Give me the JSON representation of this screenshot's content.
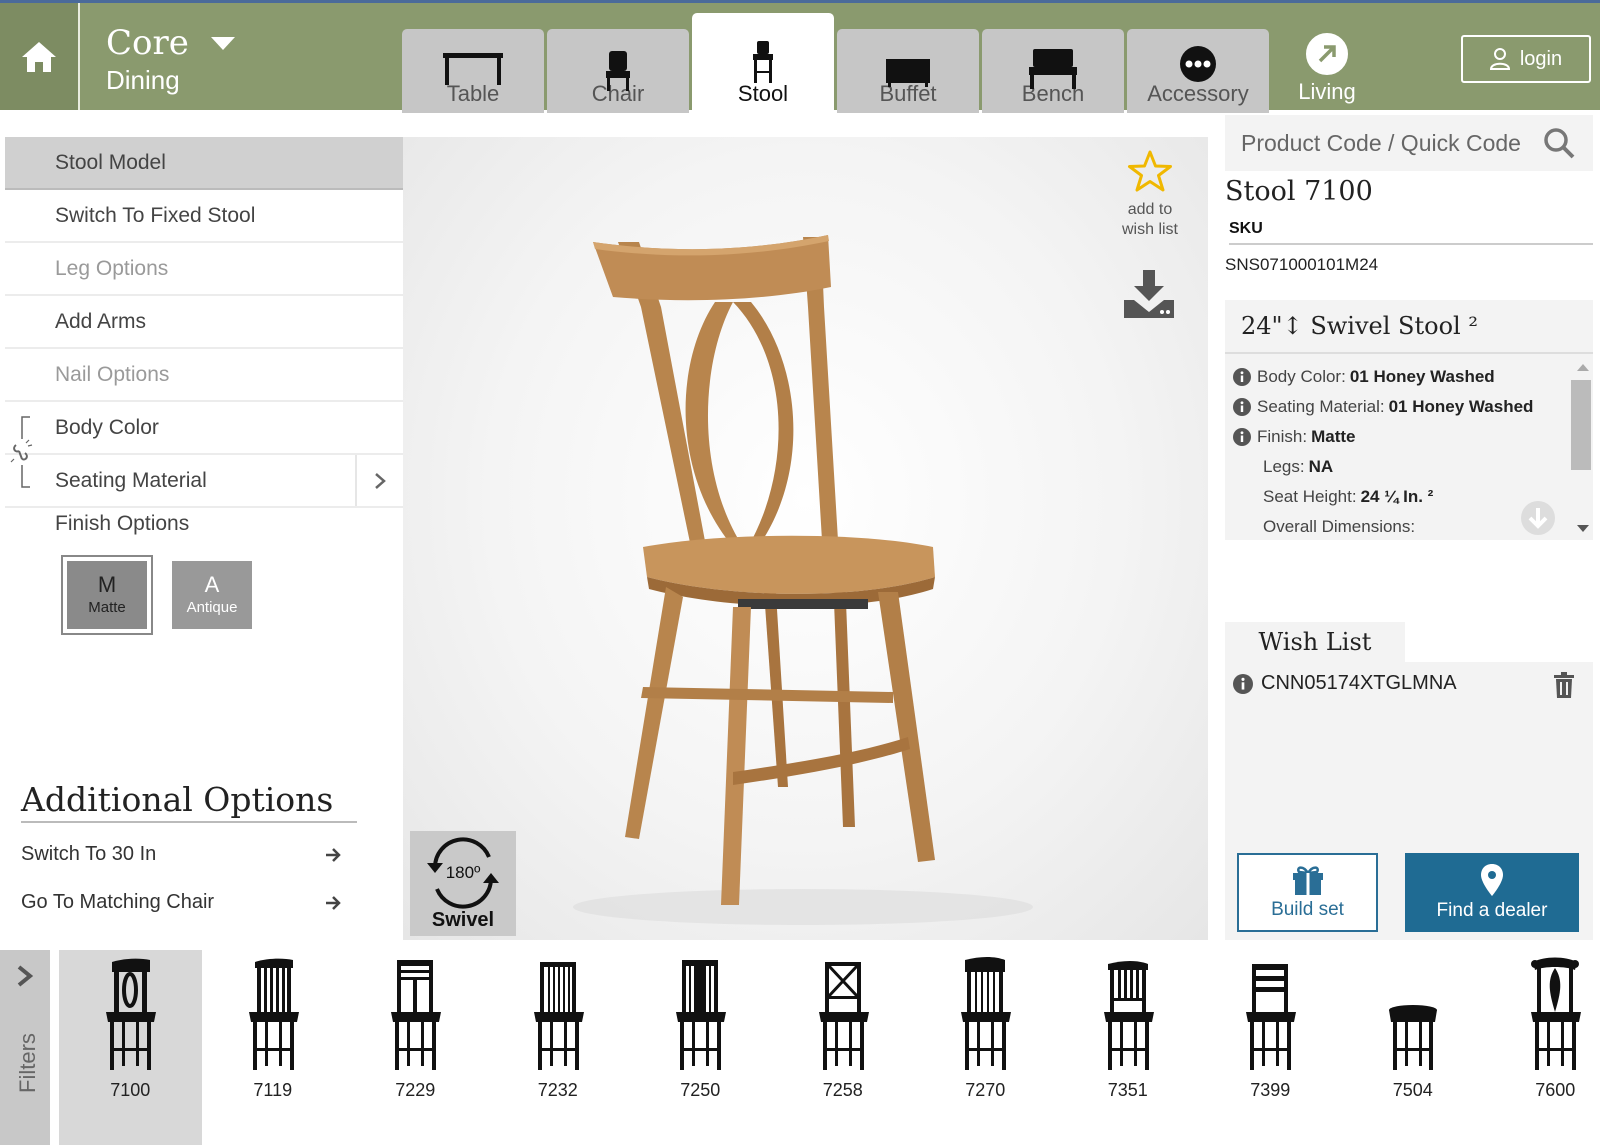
{
  "brand": {
    "line1": "Core",
    "line2": "Dining"
  },
  "tabs": [
    {
      "label": "Table",
      "icon": "table-icon",
      "active": false
    },
    {
      "label": "Chair",
      "icon": "chair-icon",
      "active": false
    },
    {
      "label": "Stool",
      "icon": "stool-icon",
      "active": true
    },
    {
      "label": "Buffet",
      "icon": "buffet-icon",
      "active": false
    },
    {
      "label": "Bench",
      "icon": "bench-icon",
      "active": false
    },
    {
      "label": "Accessory",
      "icon": "more-dots-icon",
      "active": false
    }
  ],
  "living": {
    "label": "Living"
  },
  "login": {
    "label": "login"
  },
  "menu": {
    "items": [
      {
        "label": "Stool Model"
      },
      {
        "label": "Switch To Fixed Stool"
      },
      {
        "label": "Leg Options"
      },
      {
        "label": "Add Arms"
      },
      {
        "label": "Nail Options"
      },
      {
        "label": "Body Color"
      },
      {
        "label": "Seating Material"
      }
    ],
    "finish_title": "Finish Options",
    "finishes": [
      {
        "letter": "M",
        "name": "Matte"
      },
      {
        "letter": "A",
        "name": "Antique"
      }
    ]
  },
  "additional": {
    "title": "Additional Options",
    "items": [
      {
        "label": "Switch To 30 In"
      },
      {
        "label": "Go To Matching Chair"
      }
    ]
  },
  "viewer": {
    "wish_add_line1": "add to",
    "wish_add_line2": "wish list",
    "swivel_degrees": "180º",
    "swivel_label": "Swivel"
  },
  "search": {
    "placeholder": "Product Code / Quick Code"
  },
  "product": {
    "title": "Stool 7100",
    "sku_label": "SKU",
    "sku": "SNS071000101M24",
    "spec_title": "24\"↕ Swivel Stool ²",
    "specs": [
      {
        "label": "Body Color:",
        "value": "01 Honey Washed",
        "info": true
      },
      {
        "label": "Seating Material:",
        "value": "01 Honey Washed",
        "info": true
      },
      {
        "label": "Finish:",
        "value": "Matte",
        "info": true
      },
      {
        "label": "Legs:",
        "value": "NA",
        "info": false
      },
      {
        "label": "Seat Height:",
        "value": "24 ¼ In. ²",
        "info": false
      },
      {
        "label": "Overall Dimensions:",
        "value": "",
        "info": false
      }
    ]
  },
  "wishlist": {
    "title": "Wish List",
    "items": [
      {
        "code": "CNN05174XTGLMNA"
      }
    ]
  },
  "actions": {
    "build": "Build set",
    "dealer": "Find a dealer"
  },
  "filters": {
    "label": "Filters"
  },
  "models": [
    {
      "num": "7100",
      "selected": true
    },
    {
      "num": "7119",
      "selected": false
    },
    {
      "num": "7229",
      "selected": false
    },
    {
      "num": "7232",
      "selected": false
    },
    {
      "num": "7250",
      "selected": false
    },
    {
      "num": "7258",
      "selected": false
    },
    {
      "num": "7270",
      "selected": false
    },
    {
      "num": "7351",
      "selected": false
    },
    {
      "num": "7399",
      "selected": false
    },
    {
      "num": "7504",
      "selected": false
    },
    {
      "num": "7600",
      "selected": false
    }
  ],
  "colors": {
    "header": "#8a9a6e",
    "accent": "#1f6b93",
    "wood": "#c8955c",
    "star": "#f0b800"
  }
}
